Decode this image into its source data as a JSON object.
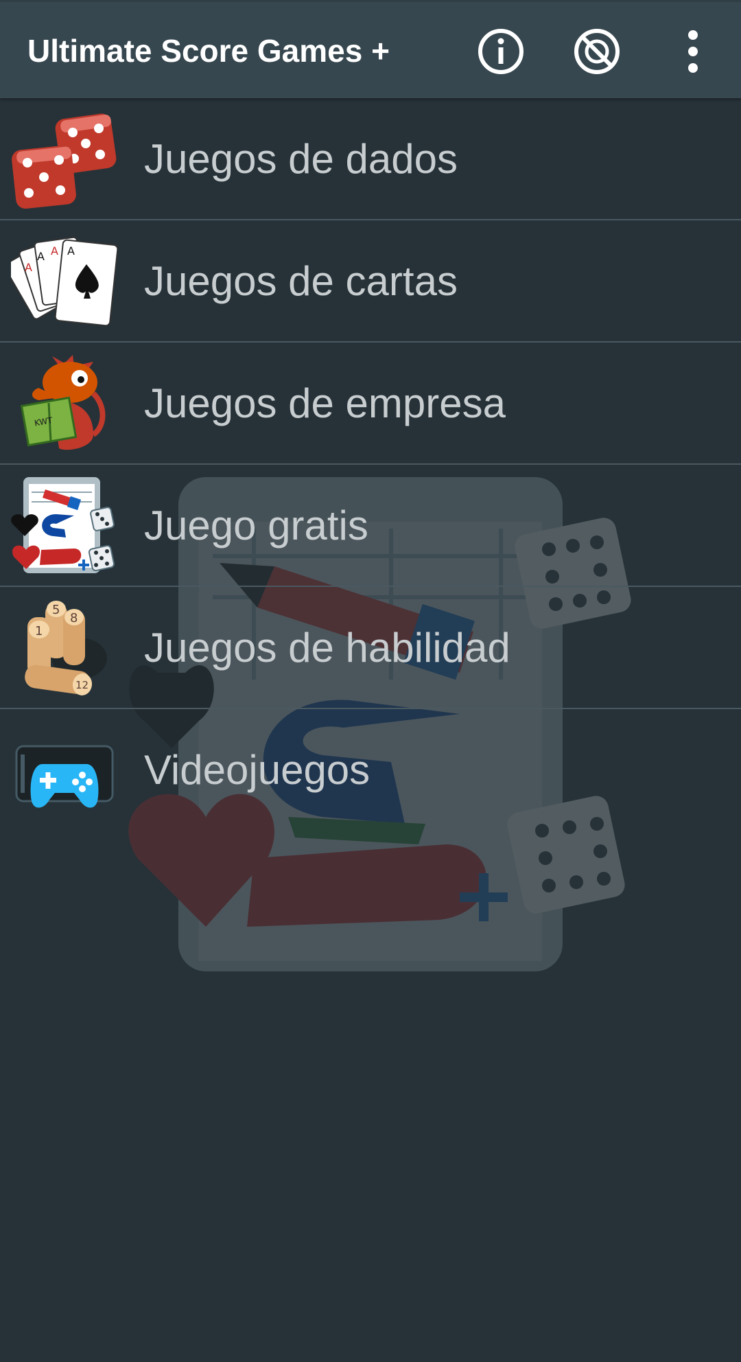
{
  "app": {
    "title": "Ultimate Score Games +"
  },
  "toolbar": {
    "actions": [
      {
        "icon": "info-icon"
      },
      {
        "icon": "no-ads-icon"
      },
      {
        "icon": "more-vert-icon"
      }
    ]
  },
  "menu": {
    "items": [
      {
        "label": "Juegos de dados",
        "icon": "dice-icon"
      },
      {
        "label": "Juegos de cartas",
        "icon": "playing-cards-icon"
      },
      {
        "label": "Juegos de empresa",
        "icon": "dragon-reading-icon"
      },
      {
        "label": "Juego gratis",
        "icon": "score-sheet-icon"
      },
      {
        "label": "Juegos de habilidad",
        "icon": "molkky-pins-icon"
      },
      {
        "label": "Videojuegos",
        "icon": "gamepad-icon"
      }
    ]
  },
  "colors": {
    "toolbar": "#37474F",
    "background": "#263238",
    "text": "#C8CDD0",
    "divider": "#4A5860"
  }
}
